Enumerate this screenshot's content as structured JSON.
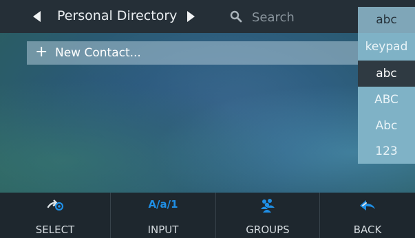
{
  "header": {
    "title": "Personal Directory",
    "prev_icon": "triangle-left-icon",
    "next_icon": "triangle-right-icon",
    "search": {
      "placeholder": "Search",
      "value": "",
      "icon": "search-icon"
    }
  },
  "list": {
    "new_contact": {
      "icon": "plus-icon",
      "label": "New Contact..."
    }
  },
  "input_mode_menu": {
    "items": [
      {
        "label": "abc",
        "state": "current"
      },
      {
        "label": "keypad",
        "state": "option"
      },
      {
        "label": "abc",
        "state": "selected"
      },
      {
        "label": "ABC",
        "state": "option"
      },
      {
        "label": "Abc",
        "state": "option"
      },
      {
        "label": "123",
        "state": "option"
      }
    ]
  },
  "softkeys": [
    {
      "label": "SELECT",
      "icon": "select-arrow-icon"
    },
    {
      "label": "INPUT",
      "icon_text": "A/a/1"
    },
    {
      "label": "GROUPS",
      "icon": "groups-people-icon"
    },
    {
      "label": "BACK",
      "icon": "back-arrow-icon"
    }
  ],
  "colors": {
    "topbar": "#252f37",
    "bottombar": "#1e272e",
    "accent": "#1f8fe6",
    "menu_selected": "#2f3a42",
    "menu_option": "#7fb2c6",
    "new_contact_bg": "#adc6d6"
  }
}
